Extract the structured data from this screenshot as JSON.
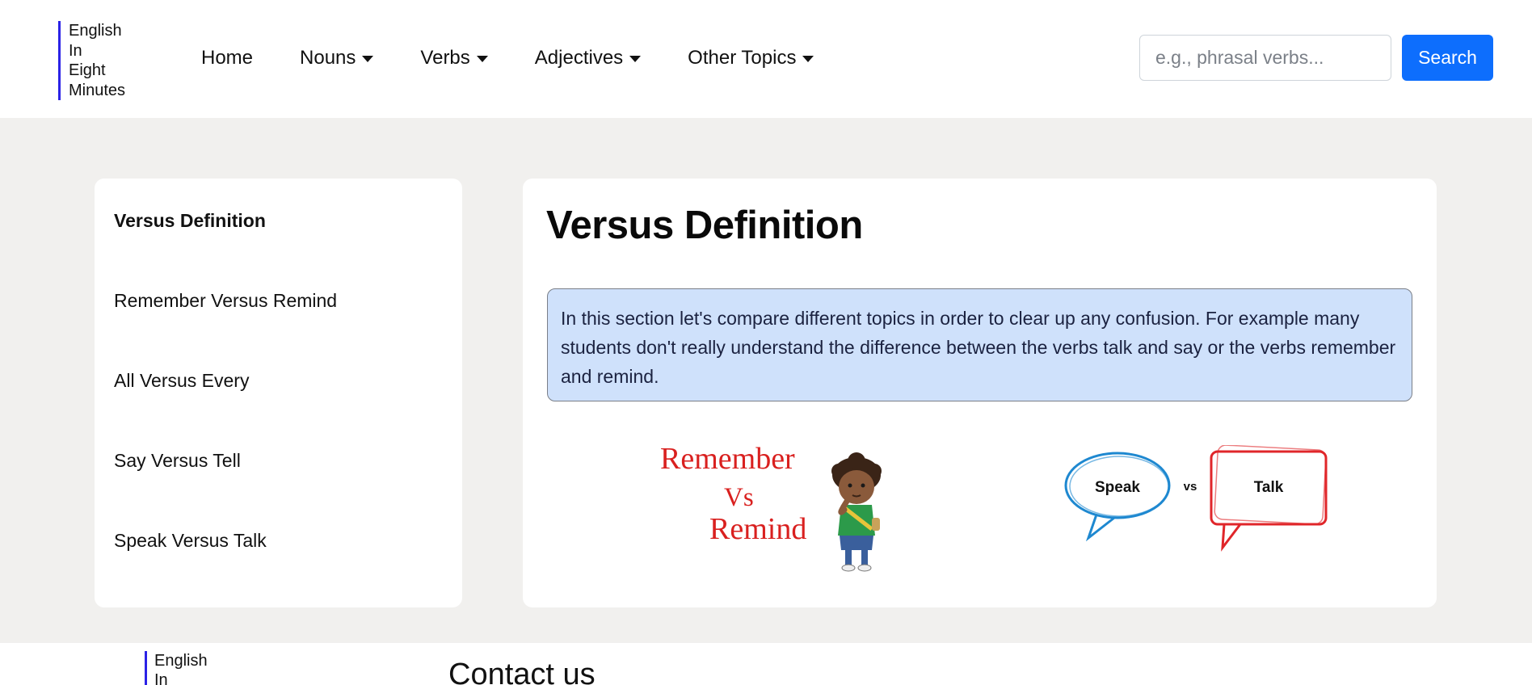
{
  "brand": {
    "line1": "English",
    "line2": "In",
    "line3": "Eight",
    "line4": "Minutes"
  },
  "nav": {
    "home": "Home",
    "nouns": "Nouns",
    "verbs": "Verbs",
    "adjectives": "Adjectives",
    "other_topics": "Other Topics"
  },
  "search": {
    "placeholder": "e.g., phrasal verbs...",
    "value": "",
    "button_label": "Search"
  },
  "sidebar": {
    "items": [
      {
        "label": "Versus Definition",
        "active": true
      },
      {
        "label": "Remember Versus Remind",
        "active": false
      },
      {
        "label": "All Versus Every",
        "active": false
      },
      {
        "label": "Say Versus Tell",
        "active": false
      },
      {
        "label": "Speak Versus Talk",
        "active": false
      }
    ]
  },
  "main": {
    "title": "Versus Definition",
    "intro": "In this section let's compare different topics in order to clear up any confusion. For example many students don't really understand the difference between the verbs talk and say or the verbs remember and remind.",
    "illustration_remind": {
      "word1": "Remember",
      "word2": "Vs",
      "word3": "Remind"
    },
    "illustration_speak": {
      "left": "Speak",
      "middle": "vs",
      "right": "Talk"
    }
  },
  "footer": {
    "brand": {
      "line1": "English",
      "line2": "In"
    },
    "contact_title": "Contact us"
  },
  "colors": {
    "brand_bar": "#2b22e6",
    "primary_button": "#0d6efd",
    "info_bg": "#cfe1fb",
    "page_bg": "#f1f0ee",
    "remind_red": "#d9201f",
    "speak_blue": "#1e88d0",
    "talk_red": "#e0262a"
  }
}
